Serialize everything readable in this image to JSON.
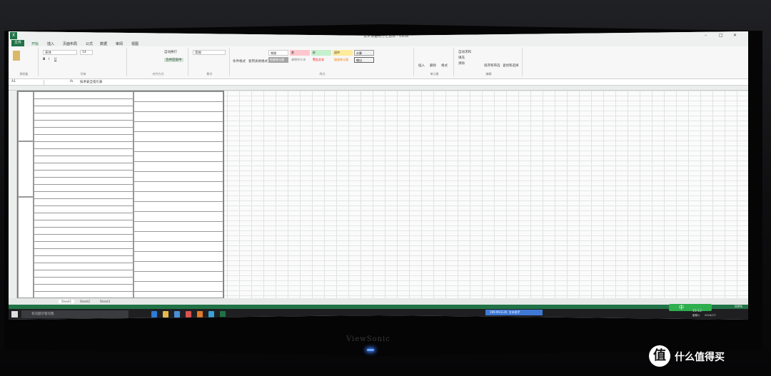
{
  "window": {
    "title": "技术设备限分汇总表 - Excel",
    "logo": "X",
    "min": "–",
    "max": "□",
    "close": "✕"
  },
  "ribbon_tabs": [
    "文件",
    "开始",
    "插入",
    "页面布局",
    "公式",
    "数据",
    "审阅",
    "视图"
  ],
  "ribbon": {
    "clipboard": "剪贴板",
    "font_name": "宋体",
    "font_size": "14",
    "font_group": "字体",
    "align_group": "对齐方式",
    "wrap": "自动换行",
    "merge": "合并后居中",
    "number_format": "常规",
    "number_group": "数字",
    "cond_format": "条件格式",
    "table_format": "套用表格格式",
    "styles": [
      "常规",
      "差",
      "好",
      "适中",
      "计算",
      "检查单元格",
      "解释性文本",
      "警告文本",
      "链接单元格",
      "输出"
    ],
    "style_group": "样式",
    "insert": "插入",
    "delete": "删除",
    "format": "格式",
    "cells_group": "单元格",
    "autosum": "自动求和",
    "fill": "填充",
    "clear": "清除",
    "sort_filter": "排序和筛选",
    "find_select": "查找和选择",
    "edit_group": "编辑"
  },
  "formula_bar": {
    "name_box": "A1",
    "fx": "fx",
    "value": "技术安全指引表"
  },
  "sheet_tabs": [
    "Sheet1",
    "Sheet2",
    "Sheet3"
  ],
  "status": {
    "zoom": "100%"
  },
  "taskbar": {
    "search_placeholder": "有问题尽管问我",
    "blue_bar_left": "199.99.8.20",
    "blue_bar_right": "文本助手",
    "time": "15:12",
    "weekday": "星期六",
    "date": "2016/7/7",
    "ime": "中"
  },
  "monitor_brand": "ViewSonic",
  "watermark": {
    "badge": "值",
    "text": "什么值得买"
  },
  "colors": {
    "excel_green": "#217346",
    "taskbar": "#1f1f22",
    "ime_green": "#2fae4e"
  }
}
